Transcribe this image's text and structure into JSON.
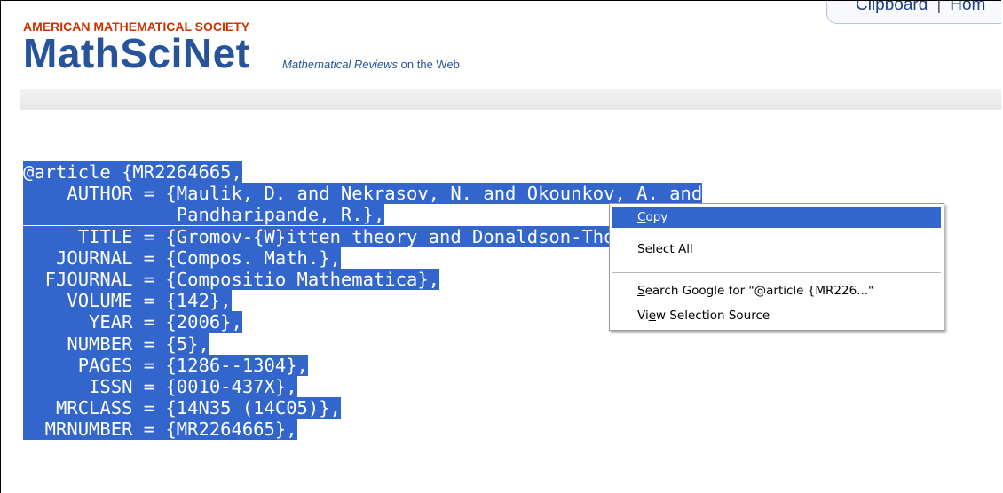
{
  "header": {
    "nav_links": [
      "Clipboard",
      "Hom"
    ],
    "nav_separator": "|",
    "org": "AMERICAN MATHEMATICAL SOCIETY",
    "logo": "MathSciNet",
    "tagline_italic": "Mathematical Reviews",
    "tagline_rest": " on the Web"
  },
  "bibtex": {
    "lines": [
      "@article {MR2264665,",
      "    AUTHOR = {Maulik, D. and Nekrasov, N. and Okounkov, A. and",
      "              Pandharipande, R.},",
      "     TITLE = {Gromov-{W}itten theory and Donaldson-Thomas theory.",
      "   JOURNAL = {Compos. Math.},",
      "  FJOURNAL = {Compositio Mathematica},",
      "    VOLUME = {142},",
      "      YEAR = {2006},",
      "    NUMBER = {5},",
      "     PAGES = {1286--1304},",
      "      ISSN = {0010-437X},",
      "   MRCLASS = {14N35 (14C05)},",
      "  MRNUMBER = {MR2264665},"
    ]
  },
  "context_menu": {
    "items": [
      {
        "label": "Copy",
        "accel": "C",
        "rest": "opy",
        "pre": "",
        "active": true
      },
      {
        "label": "Select All",
        "pre": "Select ",
        "accel": "A",
        "rest": "ll",
        "active": false
      },
      {
        "label": "Search Google for \"@article {MR226...\"",
        "pre": "",
        "accel": "S",
        "rest": "earch Google for \"@article {MR226...\"",
        "active": false
      },
      {
        "label": "View Selection Source",
        "pre": "Vi",
        "accel": "e",
        "rest": "w Selection Source",
        "active": false
      }
    ]
  },
  "colors": {
    "selection": "#3366cc",
    "brand": "#27539b",
    "ams": "#cc3300"
  }
}
